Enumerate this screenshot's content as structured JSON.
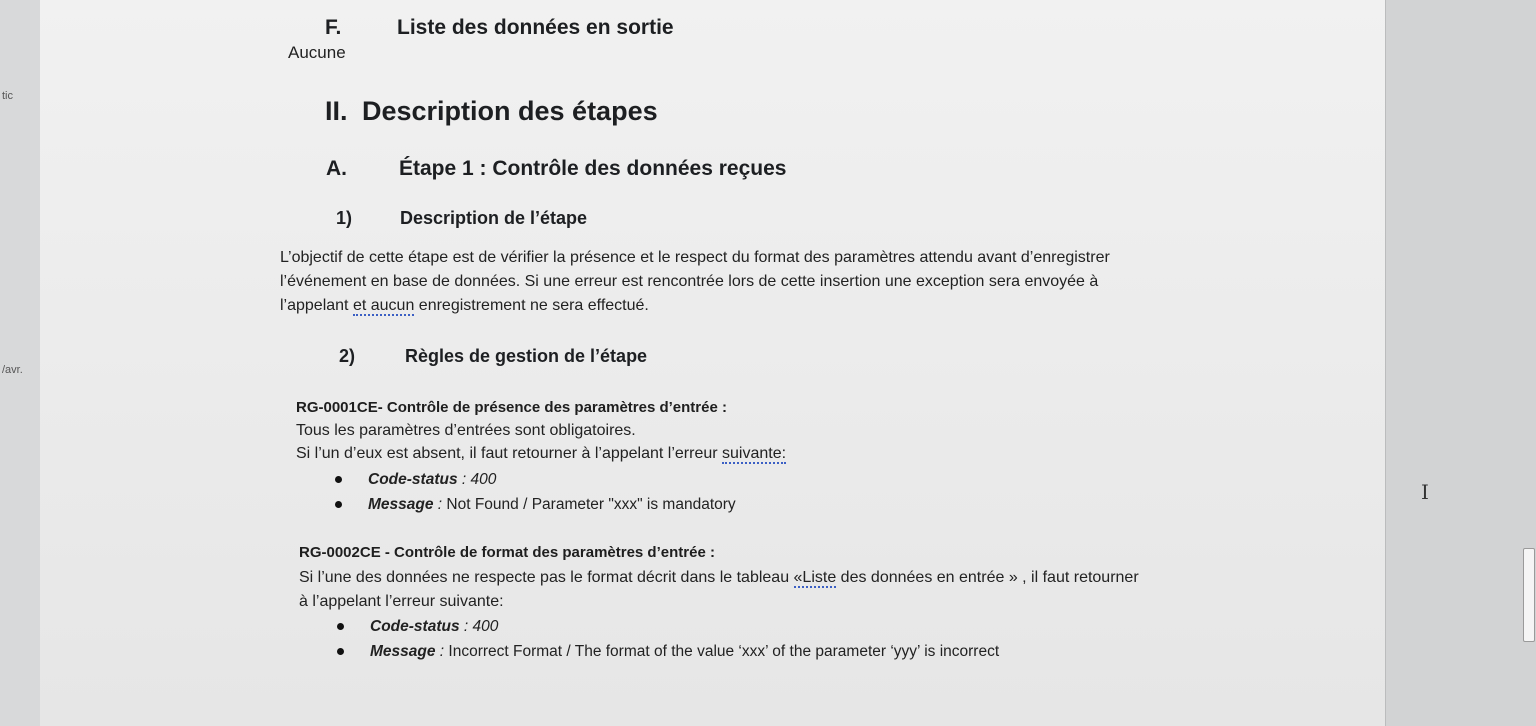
{
  "margin_comments": [
    "tic",
    "/avr."
  ],
  "section_f": {
    "number": "F.",
    "title": "Liste des données en sortie",
    "content": "Aucune"
  },
  "section_ii": {
    "number": "II.",
    "title": "Description des étapes"
  },
  "step_a": {
    "number": "A.",
    "title": "Étape 1 : Contrôle des données reçues"
  },
  "sub_1": {
    "number": "1)",
    "title": "Description de l’étape",
    "lines": [
      "L’objectif de cette étape est de vérifier la présence et le respect du format des paramètres attendu avant d’enregistrer",
      "l’événement en base de données. Si une erreur est rencontrée lors de cette insertion une exception sera envoyée à"
    ],
    "last_line_pre": "l’appelant ",
    "last_line_underlined": "et  aucun",
    "last_line_post": " enregistrement ne sera effectué."
  },
  "sub_2": {
    "number": "2)",
    "title": "Règles de gestion de l’étape"
  },
  "rule_1": {
    "title": "RG-0001CE- Contrôle de présence des paramètres d’entrée :",
    "line1": "Tous les paramètres d’entrées sont obligatoires.",
    "line2_pre": "Si l’un d’eux est absent, il faut retourner à l’appelant l’erreur ",
    "line2_underlined": "suivante:",
    "bullets": [
      {
        "label": "Code-status",
        "sep": " : ",
        "value": "400"
      },
      {
        "label": "Message",
        "sep": " : ",
        "value": "Not Found / Parameter \"xxx\" is mandatory"
      }
    ]
  },
  "rule_2": {
    "title": "RG-0002CE - Contrôle de format des paramètres d’entrée :",
    "line1_pre": "Si l’une des données ne respecte pas le format décrit dans le tableau ",
    "line1_underlined": "«Liste",
    "line1_post": " des données en entrée » ,  il faut retourner",
    "line2": "à l’appelant l’erreur suivante:",
    "bullets": [
      {
        "label": "Code-status",
        "sep": " : ",
        "value": "400"
      },
      {
        "label": "Message",
        "sep": " : ",
        "value": "Incorrect Format / The format of the value ‘xxx’ of the parameter ‘yyy’ is incorrect"
      }
    ]
  }
}
